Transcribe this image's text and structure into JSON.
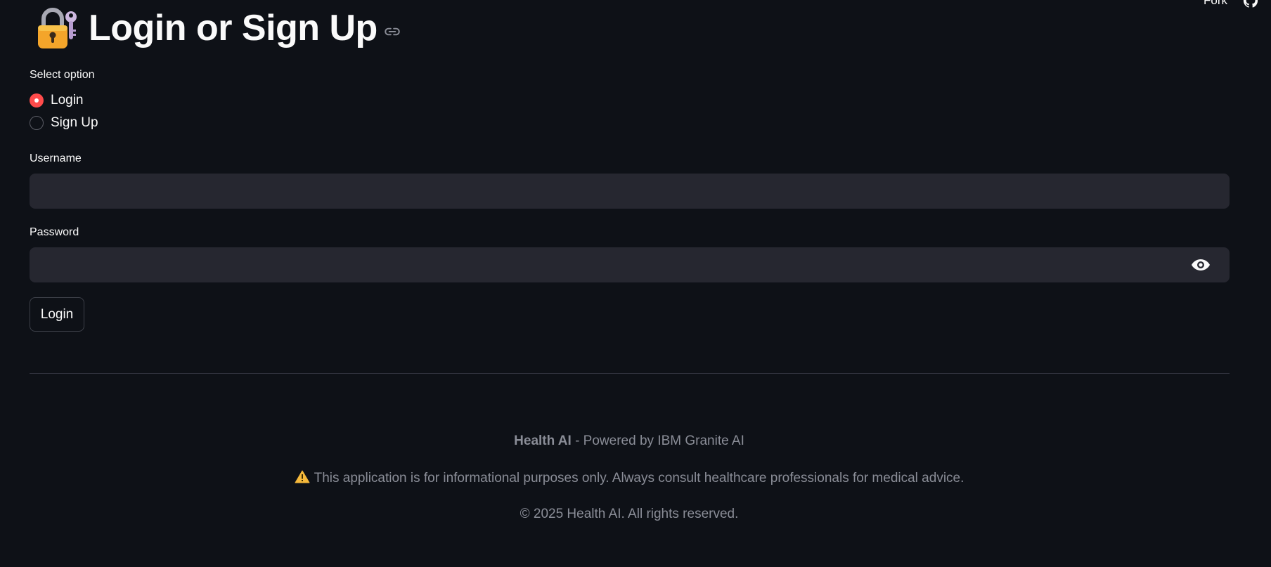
{
  "toolbar": {
    "fork_label": "Fork",
    "github_icon": "github-icon"
  },
  "header": {
    "icon": "lock-with-key-icon",
    "title": "Login or Sign Up",
    "anchor_icon": "link-icon"
  },
  "auth_mode": {
    "label": "Select option",
    "options": [
      {
        "label": "Login",
        "selected": true
      },
      {
        "label": "Sign Up",
        "selected": false
      }
    ]
  },
  "form": {
    "username": {
      "label": "Username",
      "value": "",
      "placeholder": ""
    },
    "password": {
      "label": "Password",
      "value": "",
      "placeholder": "",
      "toggle_icon": "eye-icon"
    },
    "submit_label": "Login"
  },
  "footer": {
    "brand": "Health AI",
    "powered_by": " - Powered by IBM Granite AI",
    "disclaimer_icon": "warning-icon",
    "disclaimer": "This application is for informational purposes only. Always consult healthcare professionals for medical advice.",
    "copyright": "© 2025 Health AI. All rights reserved."
  },
  "colors": {
    "background": "#0e1117",
    "accent": "#ff4b4b",
    "input_bg": "#262730",
    "muted_text": "#8a8d97"
  }
}
